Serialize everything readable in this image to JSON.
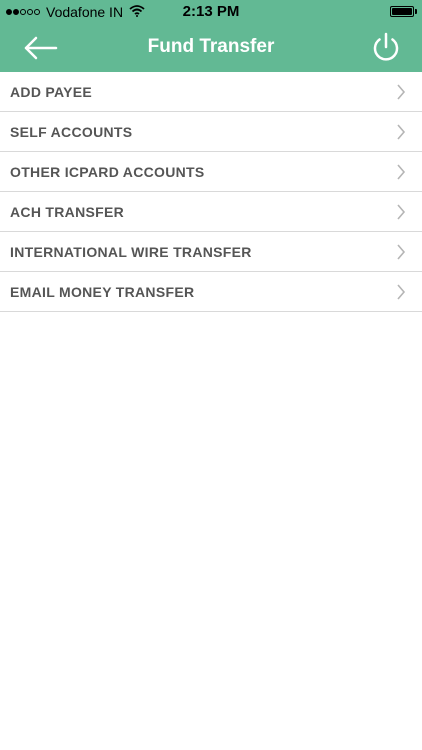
{
  "status_bar": {
    "carrier": "Vodafone IN",
    "time": "2:13 PM",
    "signal_dots_filled": 2,
    "signal_dots_total": 5,
    "battery_level": 1.0
  },
  "nav": {
    "title": "Fund Transfer",
    "back_icon": "arrow-left-icon",
    "power_icon": "power-icon"
  },
  "menu": {
    "items": [
      {
        "label": "ADD PAYEE"
      },
      {
        "label": "SELF ACCOUNTS"
      },
      {
        "label": "OTHER ICPARD ACCOUNTS"
      },
      {
        "label": "ACH TRANSFER"
      },
      {
        "label": "INTERNATIONAL WIRE TRANSFER"
      },
      {
        "label": "EMAIL MONEY TRANSFER"
      }
    ]
  },
  "colors": {
    "accent": "#62b994",
    "divider": "#d9d9d9",
    "label": "#555555",
    "chevron": "#b5b5b5"
  }
}
